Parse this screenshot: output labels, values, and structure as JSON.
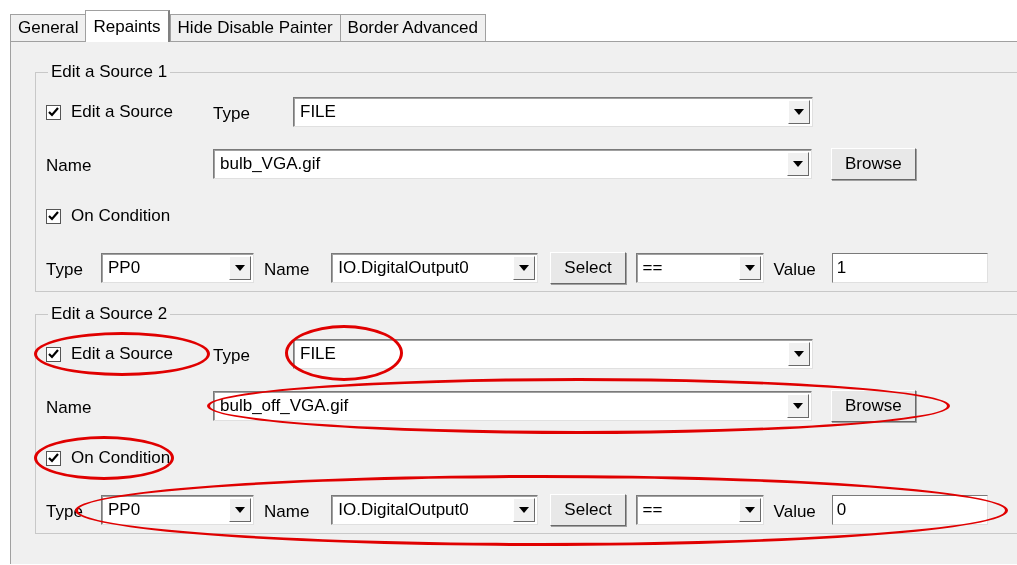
{
  "tabs": [
    {
      "label": "General",
      "selected": false
    },
    {
      "label": "Repaints",
      "selected": true
    },
    {
      "label": "Hide Disable Painter",
      "selected": false
    },
    {
      "label": "Border Advanced",
      "selected": false
    }
  ],
  "groups": [
    {
      "title": "Edit a Source 1",
      "source_check": {
        "label": "Edit a Source",
        "checked": true,
        "circled": false
      },
      "type": {
        "label": "Type",
        "value": "FILE",
        "circled": false
      },
      "name": {
        "label": "Name",
        "value": "bulb_VGA.gif",
        "browse_button": "Browse",
        "circled": false
      },
      "condition_check": {
        "label": "On Condition",
        "checked": true,
        "circled": false
      },
      "condition": {
        "type_label": "Type",
        "type_value": "PP0",
        "name_label": "Name",
        "name_value": "IO.DigitalOutput0",
        "select_button": "Select",
        "operator": "==",
        "value_label": "Value",
        "value": "1",
        "circled": false
      }
    },
    {
      "title": "Edit a Source 2",
      "source_check": {
        "label": "Edit a Source",
        "checked": true,
        "circled": true
      },
      "type": {
        "label": "Type",
        "value": "FILE",
        "circled": true
      },
      "name": {
        "label": "Name",
        "value": "bulb_off_VGA.gif",
        "browse_button": "Browse",
        "circled": true
      },
      "condition_check": {
        "label": "On Condition",
        "checked": true,
        "circled": true
      },
      "condition": {
        "type_label": "Type",
        "type_value": "PP0",
        "name_label": "Name",
        "name_value": "IO.DigitalOutput0",
        "select_button": "Select",
        "operator": "==",
        "value_label": "Value",
        "value": "0",
        "circled": true
      }
    }
  ]
}
